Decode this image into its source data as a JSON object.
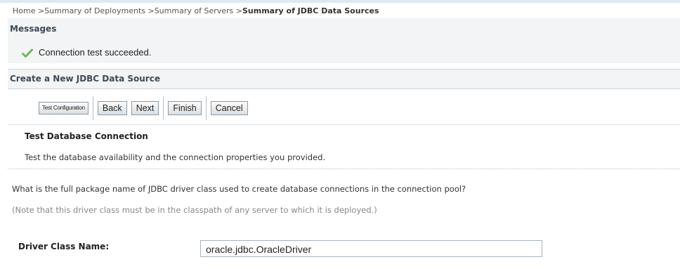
{
  "breadcrumb": {
    "items": [
      "Home",
      "Summary of Deployments",
      "Summary of Servers"
    ],
    "separator": " >",
    "current": "Summary of JDBC Data Sources"
  },
  "messages": {
    "title": "Messages",
    "items": [
      {
        "icon": "check-icon",
        "text": "Connection test succeeded."
      }
    ]
  },
  "section": {
    "title": "Create a New JDBC Data Source"
  },
  "toolbar": {
    "test_configuration_label": "Test Configuration",
    "back_label": "Back",
    "next_label": "Next",
    "finish_label": "Finish",
    "cancel_label": "Cancel"
  },
  "test": {
    "title": "Test Database Connection",
    "description": "Test the database availability and the connection properties you provided."
  },
  "question": "What is the full package name of JDBC driver class used to create database connections in the connection pool?",
  "note": "(Note that this driver class must be in the classpath of any server to which it is deployed.)",
  "driver_class": {
    "label": "Driver Class Name:",
    "value": "oracle.jdbc.OracleDriver"
  },
  "colors": {
    "success_check": "#3ca02c",
    "panel_bg": "#f2f4f5",
    "header_text": "#3d4a56"
  }
}
